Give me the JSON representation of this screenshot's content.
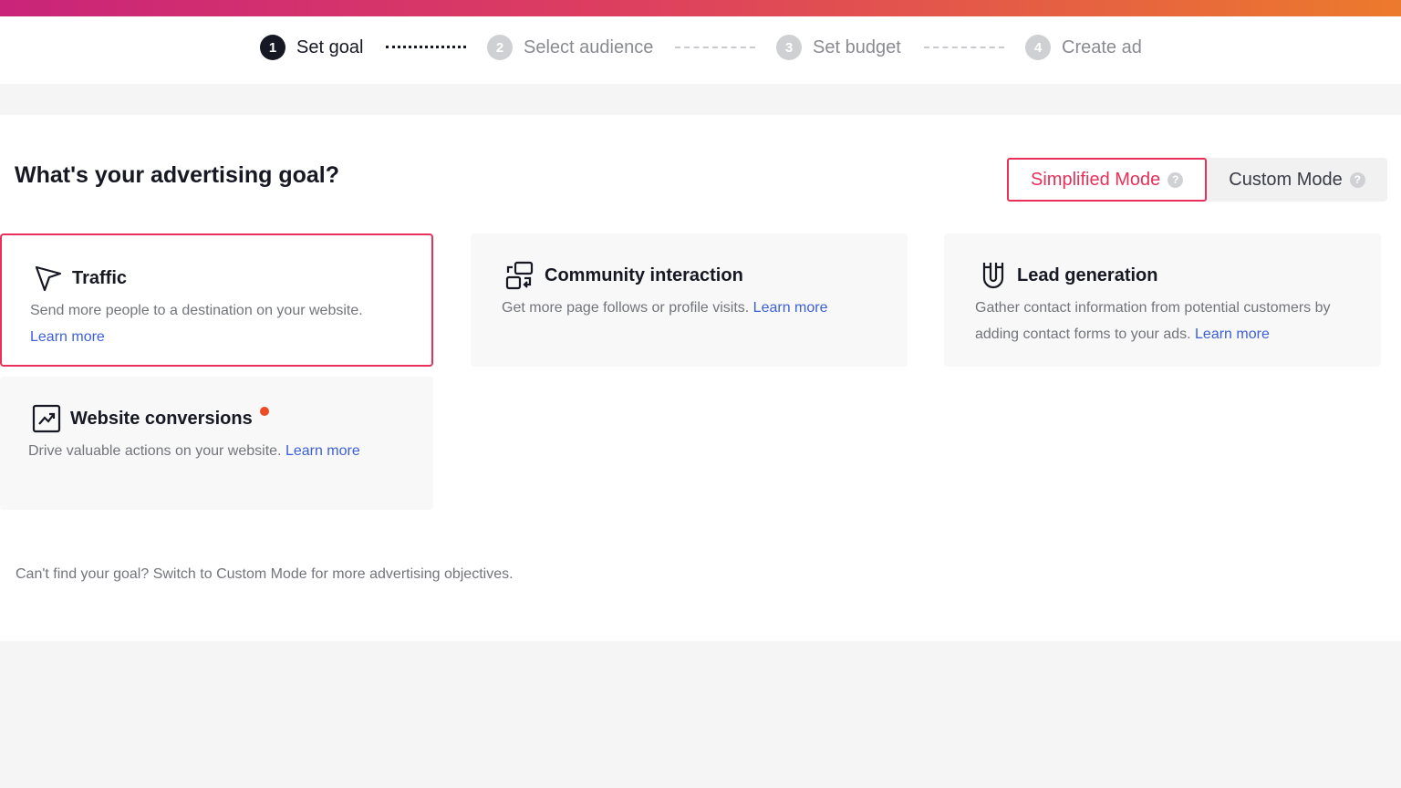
{
  "stepper": {
    "steps": [
      {
        "num": "1",
        "label": "Set goal"
      },
      {
        "num": "2",
        "label": "Select audience"
      },
      {
        "num": "3",
        "label": "Set budget"
      },
      {
        "num": "4",
        "label": "Create ad"
      }
    ]
  },
  "page": {
    "title": "What's your advertising goal?",
    "modes": {
      "simplified": "Simplified Mode",
      "custom": "Custom Mode",
      "help_glyph": "?"
    }
  },
  "goals": [
    {
      "title": "Traffic",
      "desc": "Send more people to a destination on your website.",
      "link": "Learn more",
      "icon": "cursor-arrow-icon"
    },
    {
      "title": "Community interaction",
      "desc": "Get more page follows or profile visits.",
      "link": "Learn more",
      "icon": "community-icon"
    },
    {
      "title": "Lead generation",
      "desc": "Gather contact information from potential customers by adding contact forms to your ads.",
      "link": "Learn more",
      "icon": "magnet-icon"
    },
    {
      "title": "Website conversions",
      "desc": "Drive valuable actions on your website.",
      "link": "Learn more",
      "icon": "trend-chart-icon"
    }
  ],
  "footer": {
    "note": "Can't find your goal? Switch to Custom Mode for more advertising objectives."
  },
  "colors": {
    "accent": "#e8305a",
    "link": "#3d5fd8",
    "new_badge": "#ef4a23"
  }
}
